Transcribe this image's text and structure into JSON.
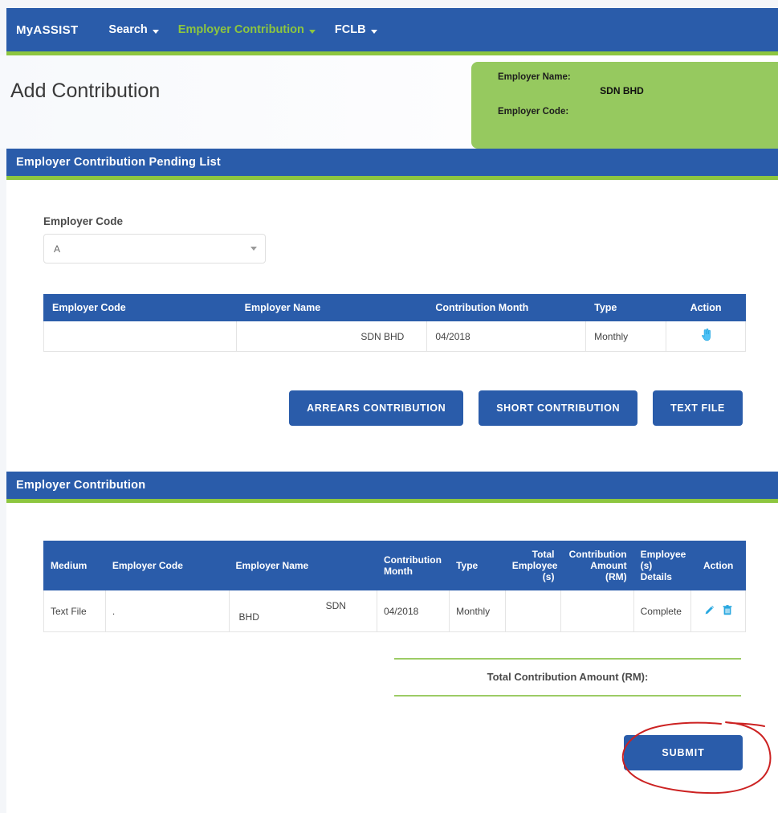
{
  "colors": {
    "brand_blue": "#2a5caa",
    "accent_green": "#8dc63f",
    "card_green": "#96c95f",
    "icon_blue": "#29a8e0",
    "hand_icon_blue": "#4fc3f7",
    "annotation_red": "#cc2222"
  },
  "navbar": {
    "brand": "MyASSIST",
    "items": [
      {
        "label": "Search",
        "has_caret": true,
        "active": false
      },
      {
        "label": "Employer Contribution",
        "has_caret": true,
        "active": true
      },
      {
        "label": "FCLB",
        "has_caret": true,
        "active": false
      }
    ]
  },
  "header": {
    "page_title": "Add Contribution",
    "employer_name_label": "Employer Name:",
    "employer_name_value": "SDN BHD",
    "employer_code_label": "Employer Code:",
    "employer_code_value": ""
  },
  "pending_panel": {
    "title": "Employer Contribution Pending List",
    "form": {
      "employer_code_label": "Employer Code",
      "employer_code_value": "A",
      "caret_icon": "chevron-down-icon"
    },
    "table": {
      "columns": [
        "Employer Code",
        "Employer Name",
        "Contribution Month",
        "Type",
        "Action"
      ],
      "rows": [
        {
          "employer_code": "",
          "employer_name": "SDN BHD",
          "contribution_month": "04/2018",
          "type": "Monthly",
          "action_icon": "pointing-hand-icon"
        }
      ]
    },
    "buttons": [
      {
        "label": "ARREARS CONTRIBUTION",
        "name": "arrears-contribution-button"
      },
      {
        "label": "SHORT CONTRIBUTION",
        "name": "short-contribution-button"
      },
      {
        "label": "TEXT FILE",
        "name": "text-file-button"
      }
    ]
  },
  "contribution_panel": {
    "title": "Employer Contribution",
    "table": {
      "columns": [
        "Medium",
        "Employer Code",
        "Employer Name",
        "Contribution Month",
        "Type",
        "Total Employee (s)",
        "Contribution Amount (RM)",
        "Employee (s) Details",
        "Action"
      ],
      "columns_multiline": {
        "contribution_month": [
          "Contribution",
          "Month"
        ],
        "total_employees": [
          "Total",
          "Employee",
          "(s)"
        ],
        "contribution_amount": [
          "Contribution",
          "Amount",
          "(RM)"
        ],
        "employee_details": [
          "Employee",
          "(s)",
          "Details"
        ]
      },
      "rows": [
        {
          "medium": "Text File",
          "employer_code": ".",
          "employer_name_line1": "SDN",
          "employer_name_line2": "BHD",
          "contribution_month": "04/2018",
          "type": "Monthly",
          "total_employees": "",
          "contribution_amount": "",
          "employee_details": "Complete",
          "edit_icon": "pencil-icon",
          "delete_icon": "trash-icon"
        }
      ]
    },
    "total_label": "Total Contribution Amount (RM):",
    "total_value": "",
    "submit_label": "SUBMIT"
  },
  "annotation": {
    "type": "hand-drawn-ellipse",
    "target": "submit-button",
    "color": "#cc2222"
  }
}
